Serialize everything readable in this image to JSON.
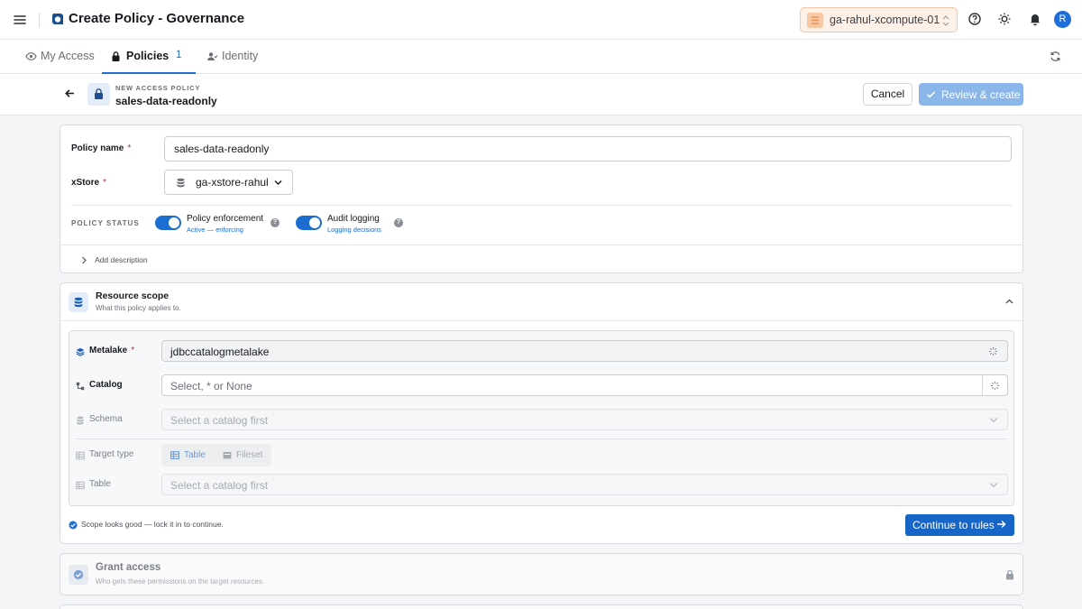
{
  "app": {
    "title": "Create Policy - Governance",
    "workspace": "ga-rahul-xcompute-01",
    "avatar_initial": "R",
    "accent": "#1c6dd0"
  },
  "tabs": [
    {
      "label": "My Access",
      "icon": "eye-icon"
    },
    {
      "label": "Policies",
      "icon": "lock-icon",
      "count": "1",
      "active": true
    },
    {
      "label": "Identity",
      "icon": "user-group-icon"
    }
  ],
  "header": {
    "eyebrow": "NEW ACCESS POLICY",
    "name": "sales-data-readonly",
    "cancel_label": "Cancel",
    "review_label": "Review & create"
  },
  "policy": {
    "name_label": "Policy name",
    "name_value": "sales-data-readonly",
    "xstore_label": "xStore",
    "xstore_value": "ga-xstore-rahul",
    "required_mark": "*",
    "status_label": "POLICY STATUS",
    "enforcement_title": "Policy enforcement",
    "enforcement_sub": "Active — enforcing",
    "enforcement_on": true,
    "audit_title": "Audit logging",
    "audit_sub": "Logging decisions",
    "audit_on": true,
    "add_description": "Add description"
  },
  "scope": {
    "title": "Resource scope",
    "subtitle": "What this policy applies to.",
    "metalake_label": "Metalake",
    "metalake_value": "jdbccatalogmetalake",
    "catalog_label": "Catalog",
    "catalog_placeholder": "Select, * or None",
    "schema_label": "Schema",
    "schema_placeholder": "Select a catalog first",
    "target_type_label": "Target type",
    "target_options": [
      "Table",
      "Fileset"
    ],
    "target_selected": "Table",
    "table_label": "Table",
    "table_placeholder": "Select a catalog first",
    "status_note": "Scope looks good — lock it in to continue.",
    "continue_label": "Continue to rules"
  },
  "grant": {
    "title": "Grant access",
    "subtitle": "Who gets these permissions on the target resources."
  }
}
